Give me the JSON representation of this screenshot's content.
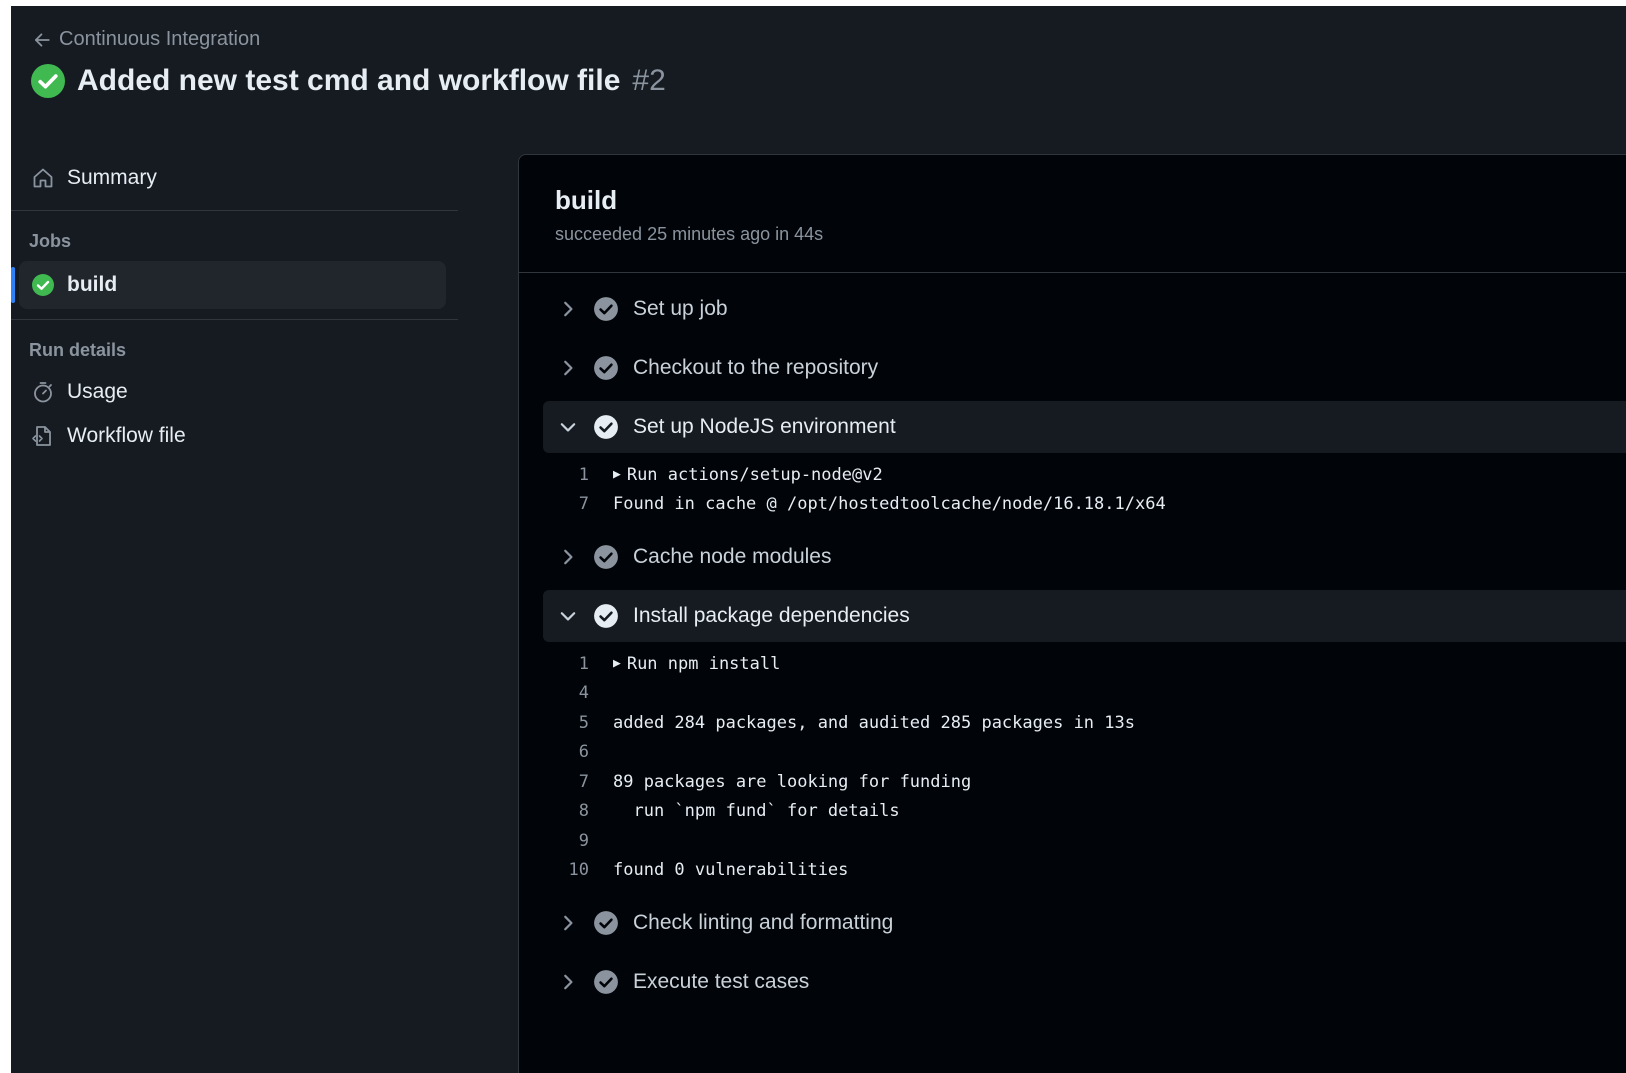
{
  "header": {
    "back_label": "Continuous Integration",
    "title": "Added new test cmd and workflow file",
    "run_number": "#2"
  },
  "sidebar": {
    "summary_label": "Summary",
    "jobs_heading": "Jobs",
    "job_label": "build",
    "run_details_heading": "Run details",
    "usage_label": "Usage",
    "workflow_file_label": "Workflow file"
  },
  "job": {
    "name": "build",
    "status": "succeeded 25 minutes ago in 44s"
  },
  "steps": [
    {
      "name": "Set up job"
    },
    {
      "name": "Checkout to the repository"
    },
    {
      "name": "Set up NodeJS environment"
    },
    {
      "name": "Cache node modules"
    },
    {
      "name": "Install package dependencies"
    },
    {
      "name": "Check linting and formatting"
    },
    {
      "name": "Execute test cases"
    }
  ],
  "logs": {
    "setup_node": [
      {
        "n": "1",
        "text": "Run actions/setup-node@v2",
        "group": true
      },
      {
        "n": "7",
        "text": "Found in cache @ /opt/hostedtoolcache/node/16.18.1/x64"
      }
    ],
    "install": [
      {
        "n": "1",
        "text": "Run npm install",
        "group": true
      },
      {
        "n": "4",
        "text": ""
      },
      {
        "n": "5",
        "text": "added 284 packages, and audited 285 packages in 13s"
      },
      {
        "n": "6",
        "text": ""
      },
      {
        "n": "7",
        "text": "89 packages are looking for funding"
      },
      {
        "n": "8",
        "text": "  run `npm fund` for details"
      },
      {
        "n": "9",
        "text": ""
      },
      {
        "n": "10",
        "text": "found 0 vulnerabilities"
      }
    ]
  },
  "colors": {
    "success": "#3fb950",
    "accent": "#2f81f7"
  }
}
